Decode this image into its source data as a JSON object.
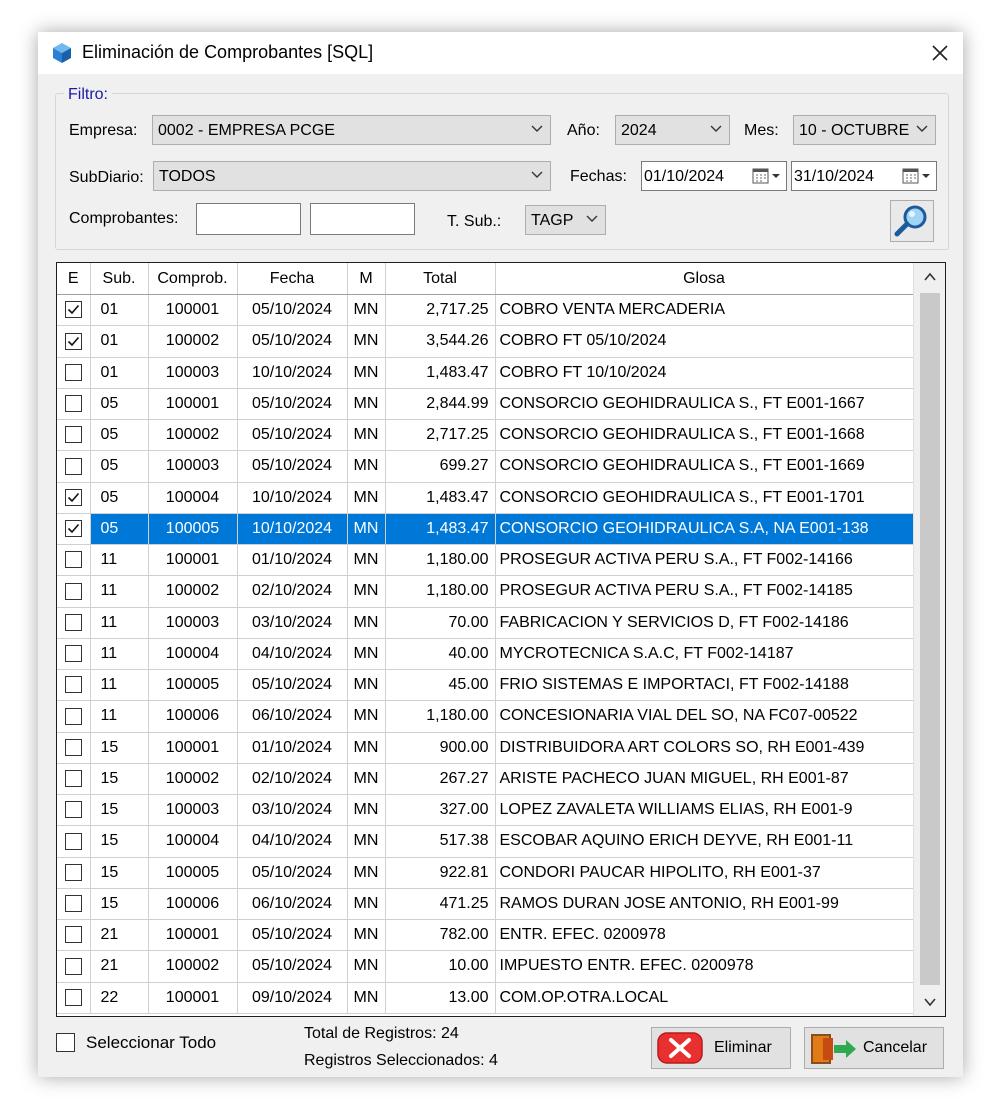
{
  "window": {
    "title": "Eliminación de Comprobantes [SQL]"
  },
  "filter": {
    "group_label": "Filtro:",
    "empresa_label": "Empresa:",
    "empresa_value": "0002 - EMPRESA PCGE",
    "anio_label": "Año:",
    "anio_value": "2024",
    "mes_label": "Mes:",
    "mes_value": "10 - OCTUBRE",
    "subdiario_label": "SubDiario:",
    "subdiario_value": "TODOS",
    "fechas_label": "Fechas:",
    "fecha_desde": "01/10/2024",
    "fecha_hasta": "31/10/2024",
    "comprobantes_label": "Comprobantes:",
    "tsub_label": "T. Sub.:",
    "tsub_value": "TAGP"
  },
  "grid": {
    "headers": [
      "E",
      "Sub.",
      "Comprob.",
      "Fecha",
      "M",
      "Total",
      "Glosa"
    ],
    "rows": [
      {
        "e": true,
        "sub": "01",
        "comp": "100001",
        "fecha": "05/10/2024",
        "m": "MN",
        "total": "2,717.25",
        "glosa": "COBRO VENTA MERCADERIA"
      },
      {
        "e": true,
        "sub": "01",
        "comp": "100002",
        "fecha": "05/10/2024",
        "m": "MN",
        "total": "3,544.26",
        "glosa": "COBRO FT 05/10/2024"
      },
      {
        "e": false,
        "sub": "01",
        "comp": "100003",
        "fecha": "10/10/2024",
        "m": "MN",
        "total": "1,483.47",
        "glosa": "COBRO FT 10/10/2024"
      },
      {
        "e": false,
        "sub": "05",
        "comp": "100001",
        "fecha": "05/10/2024",
        "m": "MN",
        "total": "2,844.99",
        "glosa": "CONSORCIO GEOHIDRAULICA S., FT E001-1667"
      },
      {
        "e": false,
        "sub": "05",
        "comp": "100002",
        "fecha": "05/10/2024",
        "m": "MN",
        "total": "2,717.25",
        "glosa": "CONSORCIO GEOHIDRAULICA S., FT E001-1668"
      },
      {
        "e": false,
        "sub": "05",
        "comp": "100003",
        "fecha": "05/10/2024",
        "m": "MN",
        "total": "699.27",
        "glosa": "CONSORCIO GEOHIDRAULICA S., FT E001-1669"
      },
      {
        "e": true,
        "sub": "05",
        "comp": "100004",
        "fecha": "10/10/2024",
        "m": "MN",
        "total": "1,483.47",
        "glosa": "CONSORCIO GEOHIDRAULICA S., FT E001-1701"
      },
      {
        "e": true,
        "sub": "05",
        "comp": "100005",
        "fecha": "10/10/2024",
        "m": "MN",
        "total": "1,483.47",
        "glosa": "CONSORCIO GEOHIDRAULICA S.A, NA E001-138",
        "selected": true
      },
      {
        "e": false,
        "sub": "11",
        "comp": "100001",
        "fecha": "01/10/2024",
        "m": "MN",
        "total": "1,180.00",
        "glosa": "PROSEGUR ACTIVA PERU S.A., FT F002-14166"
      },
      {
        "e": false,
        "sub": "11",
        "comp": "100002",
        "fecha": "02/10/2024",
        "m": "MN",
        "total": "1,180.00",
        "glosa": "PROSEGUR ACTIVA PERU S.A., FT F002-14185"
      },
      {
        "e": false,
        "sub": "11",
        "comp": "100003",
        "fecha": "03/10/2024",
        "m": "MN",
        "total": "70.00",
        "glosa": "FABRICACION Y SERVICIOS D, FT F002-14186"
      },
      {
        "e": false,
        "sub": "11",
        "comp": "100004",
        "fecha": "04/10/2024",
        "m": "MN",
        "total": "40.00",
        "glosa": "MYCROTECNICA S.A.C, FT F002-14187"
      },
      {
        "e": false,
        "sub": "11",
        "comp": "100005",
        "fecha": "05/10/2024",
        "m": "MN",
        "total": "45.00",
        "glosa": "FRIO SISTEMAS E IMPORTACI, FT F002-14188"
      },
      {
        "e": false,
        "sub": "11",
        "comp": "100006",
        "fecha": "06/10/2024",
        "m": "MN",
        "total": "1,180.00",
        "glosa": "CONCESIONARIA VIAL DEL SO, NA FC07-00522"
      },
      {
        "e": false,
        "sub": "15",
        "comp": "100001",
        "fecha": "01/10/2024",
        "m": "MN",
        "total": "900.00",
        "glosa": "DISTRIBUIDORA ART COLORS SO, RH E001-439"
      },
      {
        "e": false,
        "sub": "15",
        "comp": "100002",
        "fecha": "02/10/2024",
        "m": "MN",
        "total": "267.27",
        "glosa": "ARISTE PACHECO JUAN MIGUEL, RH E001-87"
      },
      {
        "e": false,
        "sub": "15",
        "comp": "100003",
        "fecha": "03/10/2024",
        "m": "MN",
        "total": "327.00",
        "glosa": "LOPEZ ZAVALETA WILLIAMS ELIAS, RH E001-9"
      },
      {
        "e": false,
        "sub": "15",
        "comp": "100004",
        "fecha": "04/10/2024",
        "m": "MN",
        "total": "517.38",
        "glosa": "ESCOBAR AQUINO ERICH DEYVE, RH E001-11"
      },
      {
        "e": false,
        "sub": "15",
        "comp": "100005",
        "fecha": "05/10/2024",
        "m": "MN",
        "total": "922.81",
        "glosa": "CONDORI PAUCAR HIPOLITO, RH E001-37"
      },
      {
        "e": false,
        "sub": "15",
        "comp": "100006",
        "fecha": "06/10/2024",
        "m": "MN",
        "total": "471.25",
        "glosa": "RAMOS DURAN JOSE ANTONIO, RH E001-99"
      },
      {
        "e": false,
        "sub": "21",
        "comp": "100001",
        "fecha": "05/10/2024",
        "m": "MN",
        "total": "782.00",
        "glosa": "ENTR. EFEC. 0200978"
      },
      {
        "e": false,
        "sub": "21",
        "comp": "100002",
        "fecha": "05/10/2024",
        "m": "MN",
        "total": "10.00",
        "glosa": "IMPUESTO ENTR. EFEC. 0200978"
      },
      {
        "e": false,
        "sub": "22",
        "comp": "100001",
        "fecha": "09/10/2024",
        "m": "MN",
        "total": "13.00",
        "glosa": "COM.OP.OTRA.LOCAL"
      }
    ]
  },
  "footer": {
    "select_all_label": "Seleccionar Todo",
    "total_registros": "Total de Registros: 24",
    "registros_seleccionados": "Registros Seleccionados: 4",
    "eliminar_label": "Eliminar",
    "cancelar_label": "Cancelar"
  },
  "colors": {
    "selection": "#0078d7",
    "group_label": "#1a1aa6",
    "window_bg": "#f0f0f0"
  },
  "icons": {
    "app": "cube-icon",
    "close": "close-icon",
    "search": "magnifier-icon",
    "delete": "x-icon",
    "exit": "exit-door-icon"
  }
}
